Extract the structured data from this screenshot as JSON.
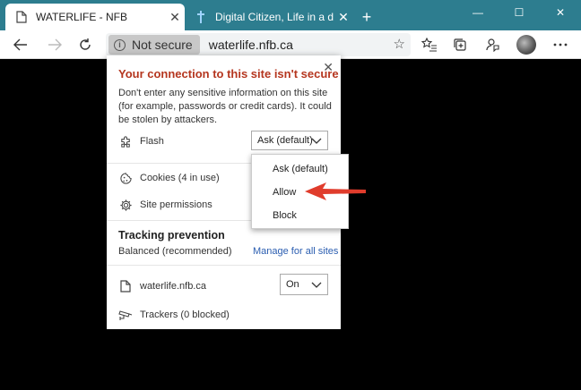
{
  "tabs": [
    {
      "title": "WATERLIFE - NFB",
      "close": "✕"
    },
    {
      "title": "Digital Citizen, Life in a digital wo",
      "close": "✕"
    }
  ],
  "new_tab": "+",
  "window_controls": {
    "minimize": "—",
    "maximize": "☐",
    "close": "✕"
  },
  "address": {
    "security_label": "Not secure",
    "info_glyph": "i",
    "url": "waterlife.nfb.ca",
    "favorite_glyph": "☆"
  },
  "popup": {
    "close": "✕",
    "heading": "Your connection to this site isn't secure",
    "description": "Don't enter any sensitive information on this site (for example, passwords or credit cards). It could be stolen by attackers.",
    "flash_label": "Flash",
    "flash_value": "Ask (default)",
    "cookies_label": "Cookies (4 in use)",
    "site_permissions_label": "Site permissions",
    "tracking_title": "Tracking prevention",
    "tracking_level": "Balanced (recommended)",
    "manage_link": "Manage for all sites",
    "site_label": "waterlife.nfb.ca",
    "site_toggle_value": "On",
    "trackers_label": "Trackers (0 blocked)"
  },
  "dropdown_options": [
    "Ask (default)",
    "Allow",
    "Block"
  ],
  "colors": {
    "tab_bar": "#2d7d8f",
    "heading": "#b5361f",
    "link": "#2a5db0",
    "arrow": "#e03c2c"
  }
}
